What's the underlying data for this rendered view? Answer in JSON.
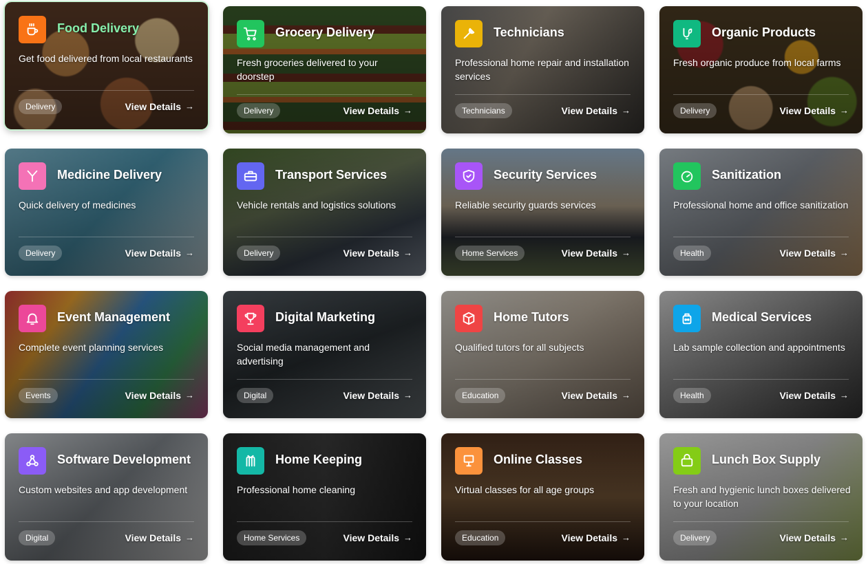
{
  "cards": [
    {
      "title": "Food Delivery",
      "description": "Get food delivered from local restaurants",
      "badge": "Delivery",
      "cta": "View Details",
      "icon": "coffee-cup-icon",
      "icon_color": "#f97316"
    },
    {
      "title": "Grocery Delivery",
      "description": "Fresh groceries delivered to your doorstep",
      "badge": "Delivery",
      "cta": "View Details",
      "icon": "shopping-cart-icon",
      "icon_color": "#22c55e"
    },
    {
      "title": "Technicians",
      "description": "Professional home repair and installation services",
      "badge": "Technicians",
      "cta": "View Details",
      "icon": "wrench-icon",
      "icon_color": "#eab308"
    },
    {
      "title": "Organic Products",
      "description": "Fresh organic produce from local farms",
      "badge": "Delivery",
      "cta": "View Details",
      "icon": "sprout-icon",
      "icon_color": "#10b981"
    },
    {
      "title": "Medicine Delivery",
      "description": "Quick delivery of medicines",
      "badge": "Delivery",
      "cta": "View Details",
      "icon": "medicine-icon",
      "icon_color": "#f472b6"
    },
    {
      "title": "Transport Services",
      "description": "Vehicle rentals and logistics solutions",
      "badge": "Delivery",
      "cta": "View Details",
      "icon": "briefcase-icon",
      "icon_color": "#6366f1"
    },
    {
      "title": "Security Services",
      "description": "Reliable security guards services",
      "badge": "Home Services",
      "cta": "View Details",
      "icon": "shield-check-icon",
      "icon_color": "#a855f7"
    },
    {
      "title": "Sanitization",
      "description": "Professional home and office sanitization",
      "badge": "Health",
      "cta": "View Details",
      "icon": "gauge-icon",
      "icon_color": "#22c55e"
    },
    {
      "title": "Event Management",
      "description": "Complete event planning services",
      "badge": "Events",
      "cta": "View Details",
      "icon": "bell-icon",
      "icon_color": "#ec4899"
    },
    {
      "title": "Digital Marketing",
      "description": "Social media management and advertising",
      "badge": "Digital",
      "cta": "View Details",
      "icon": "trophy-icon",
      "icon_color": "#f43f5e"
    },
    {
      "title": "Home Tutors",
      "description": "Qualified tutors for all subjects",
      "badge": "Education",
      "cta": "View Details",
      "icon": "cube-icon",
      "icon_color": "#ef4444"
    },
    {
      "title": "Medical Services",
      "description": "Lab sample collection and appointments",
      "badge": "Health",
      "cta": "View Details",
      "icon": "lab-kit-icon",
      "icon_color": "#0ea5e9"
    },
    {
      "title": "Software Development",
      "description": "Custom websites and app development",
      "badge": "Digital",
      "cta": "View Details",
      "icon": "webhook-icon",
      "icon_color": "#8b5cf6"
    },
    {
      "title": "Home Keeping",
      "description": "Professional home cleaning",
      "badge": "Home Services",
      "cta": "View Details",
      "icon": "broom-icon",
      "icon_color": "#14b8a6"
    },
    {
      "title": "Online Classes",
      "description": "Virtual classes for all age groups",
      "badge": "Education",
      "cta": "View Details",
      "icon": "presentation-icon",
      "icon_color": "#fb923c"
    },
    {
      "title": "Lunch Box Supply",
      "description": "Fresh and hygienic lunch boxes delivered to your location",
      "badge": "Delivery",
      "cta": "View Details",
      "icon": "lunch-box-icon",
      "icon_color": "#84cc16"
    }
  ]
}
